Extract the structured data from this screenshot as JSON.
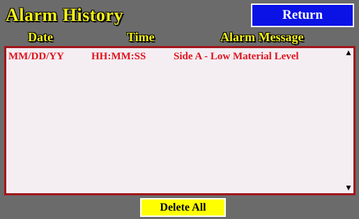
{
  "header": {
    "title": "Alarm History",
    "return_label": "Return"
  },
  "columns": {
    "date": "Date",
    "time": "Time",
    "message": "Alarm Message"
  },
  "alarms": [
    {
      "date": "MM/DD/YY",
      "time": "HH:MM:SS",
      "message": "Side A - Low Material Level"
    }
  ],
  "scrollbar": {
    "up_glyph": "▲",
    "down_glyph": "▼"
  },
  "footer": {
    "delete_all_label": "Delete All"
  },
  "colors": {
    "background": "#6b6b6b",
    "title_yellow": "#f5f21a",
    "return_blue": "#0a12e6",
    "alarm_red": "#e0141e",
    "list_border": "#a3151a",
    "delete_yellow": "#ffff00"
  }
}
